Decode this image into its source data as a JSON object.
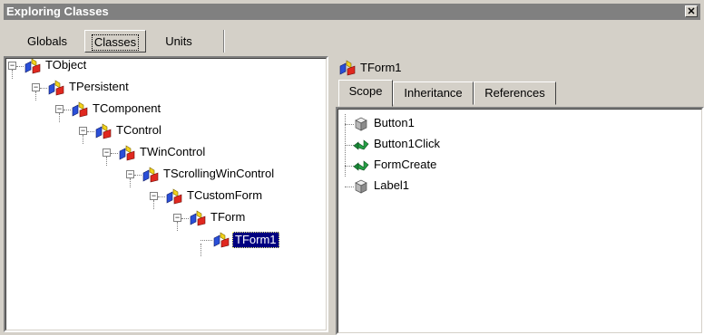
{
  "window": {
    "title": "Exploring Classes",
    "close_glyph": "✕"
  },
  "top_tabs": [
    {
      "label": "Globals",
      "active": false
    },
    {
      "label": "Classes",
      "active": true
    },
    {
      "label": "Units",
      "active": false
    }
  ],
  "class_tree": [
    {
      "label": "TObject",
      "icon": "class-icon",
      "expander": "⊟"
    },
    {
      "label": "TPersistent",
      "icon": "class-icon",
      "expander": "⊟"
    },
    {
      "label": "TComponent",
      "icon": "class-icon",
      "expander": "⊟"
    },
    {
      "label": "TControl",
      "icon": "class-icon",
      "expander": "⊟"
    },
    {
      "label": "TWinControl",
      "icon": "class-icon",
      "expander": "⊟"
    },
    {
      "label": "TScrollingWinControl",
      "icon": "class-icon",
      "expander": "⊟"
    },
    {
      "label": "TCustomForm",
      "icon": "class-icon",
      "expander": "⊟"
    },
    {
      "label": "TForm",
      "icon": "class-icon",
      "expander": "⊟"
    },
    {
      "label": "TForm1",
      "icon": "class-icon",
      "selected": true
    }
  ],
  "detail": {
    "header_label": "TForm1",
    "tabs": [
      {
        "label": "Scope",
        "active": true
      },
      {
        "label": "Inheritance",
        "active": false
      },
      {
        "label": "References",
        "active": false
      }
    ],
    "members": [
      {
        "label": "Button1",
        "icon": "field-icon"
      },
      {
        "label": "Button1Click",
        "icon": "method-icon"
      },
      {
        "label": "FormCreate",
        "icon": "method-icon"
      },
      {
        "label": "Label1",
        "icon": "field-icon"
      }
    ]
  },
  "colors": {
    "selection": "#000080",
    "face": "#d4d0c8",
    "titlebar": "#808080",
    "method_green": "#1a8a3a"
  }
}
